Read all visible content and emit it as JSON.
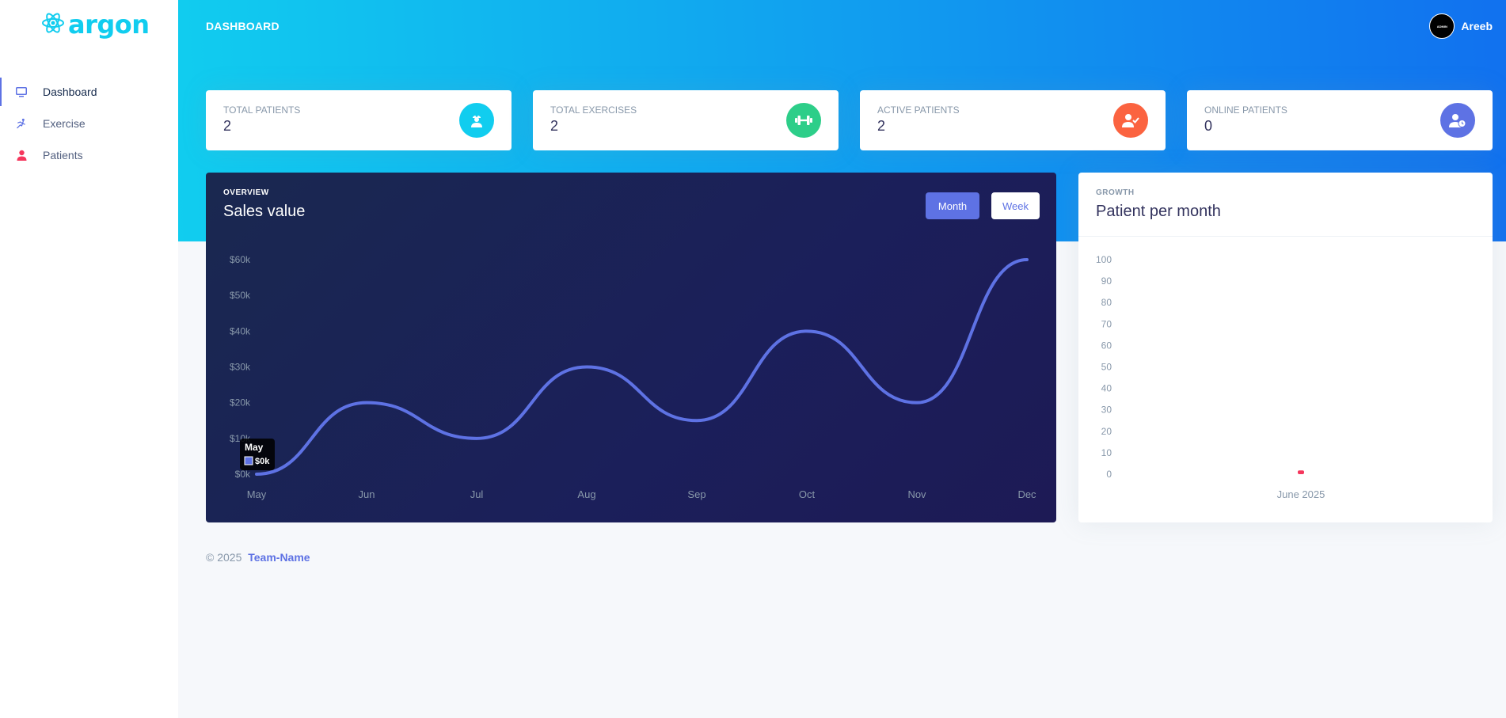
{
  "brand": {
    "name": "argon"
  },
  "sidebar": {
    "items": [
      {
        "label": "Dashboard",
        "icon": "monitor-icon",
        "active": true
      },
      {
        "label": "Exercise",
        "icon": "running-icon",
        "active": false
      },
      {
        "label": "Patients",
        "icon": "user-icon",
        "active": false
      }
    ]
  },
  "header": {
    "title": "DASHBOARD",
    "user_name": "Areeb",
    "avatar_text": "ADMIN"
  },
  "stats": [
    {
      "label": "TOTAL PATIENTS",
      "value": "2",
      "icon": "nurse-icon",
      "color": "#11cdef"
    },
    {
      "label": "TOTAL EXERCISES",
      "value": "2",
      "icon": "dumbbell-icon",
      "color": "#2dce89"
    },
    {
      "label": "ACTIVE PATIENTS",
      "value": "2",
      "icon": "user-check-icon",
      "color": "#fb6340"
    },
    {
      "label": "ONLINE PATIENTS",
      "value": "0",
      "icon": "user-clock-icon",
      "color": "#5e72e4"
    }
  ],
  "sales": {
    "eyebrow": "OVERVIEW",
    "title": "Sales value",
    "month_label": "Month",
    "week_label": "Week",
    "tooltip": {
      "title": "May",
      "value": "$0k"
    }
  },
  "growth": {
    "eyebrow": "GROWTH",
    "title": "Patient per month"
  },
  "footer": {
    "copyright": "© 2025",
    "team": "Team-Name"
  },
  "chart_data": [
    {
      "type": "line",
      "title": "Sales value",
      "categories": [
        "May",
        "Jun",
        "Jul",
        "Aug",
        "Sep",
        "Oct",
        "Nov",
        "Dec"
      ],
      "values": [
        0,
        20,
        10,
        30,
        15,
        40,
        20,
        60
      ],
      "ylim": [
        0,
        60
      ],
      "yticks": [
        "$0k",
        "$10k",
        "$20k",
        "$30k",
        "$40k",
        "$50k",
        "$60k"
      ],
      "line_color": "#5e72e4",
      "grid": false
    },
    {
      "type": "bar",
      "title": "Patient per month",
      "categories": [
        "June 2025"
      ],
      "values": [
        1
      ],
      "ylim": [
        0,
        100
      ],
      "yticks": [
        "0",
        "10",
        "20",
        "30",
        "40",
        "50",
        "60",
        "70",
        "80",
        "90",
        "100"
      ],
      "bar_color": "#f5365c",
      "grid": false
    }
  ]
}
